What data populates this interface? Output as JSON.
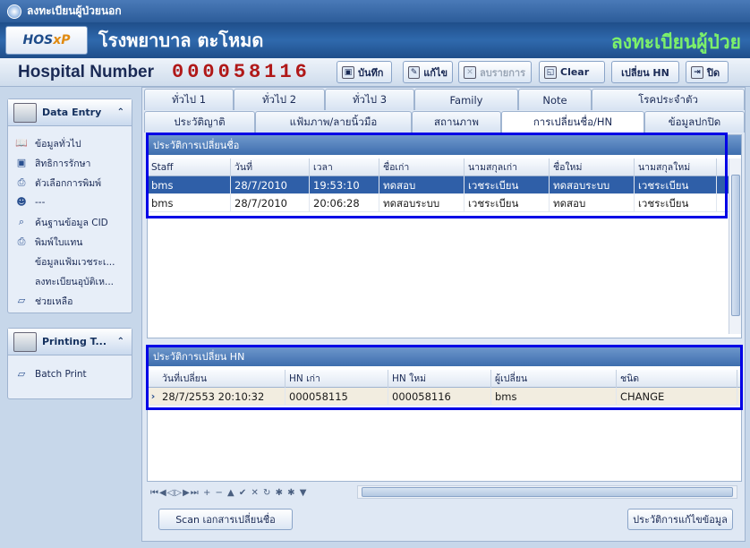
{
  "window": {
    "title": "ลงทะเบียนผู้ป่วยนอก"
  },
  "banner": {
    "logo_hos": "HOS",
    "logo_xp": "xP",
    "hospital": "โรงพยาบาล ตะโหมด",
    "register_title": "ลงทะเบียนผู้ป่วย"
  },
  "toolbar": {
    "hn_label": "Hospital Number",
    "hn_value": "000058116",
    "save_label": "บันทึก",
    "edit_label": "แก้ไข",
    "delete_label": "ลบรายการ",
    "clear_label": "Clear",
    "change_hn_label": "เปลี่ยน HN",
    "close_label": "ปิด"
  },
  "sidebar": {
    "data_entry_title": "Data Entry",
    "items": [
      {
        "label": "ข้อมูลทั่วไป",
        "icon": "book-icon"
      },
      {
        "label": "สิทธิการรักษา",
        "icon": "card-icon"
      },
      {
        "label": "ตัวเลือกการพิมพ์",
        "icon": "printer-icon"
      },
      {
        "label": "---",
        "icon": "users-icon"
      },
      {
        "label": "ค้นฐานข้อมูล CID",
        "icon": "search-db-icon"
      },
      {
        "label": "พิมพ์ใบแทน",
        "icon": "printer-icon"
      },
      {
        "label": "ข้อมูลแฟ้มเวชระเ...",
        "icon": ""
      },
      {
        "label": "ลงทะเบียนอุบัติเห...",
        "icon": ""
      },
      {
        "label": "ช่วยเหลือ",
        "icon": "help-icon"
      }
    ],
    "printing_title": "Printing T...",
    "printing_items": [
      {
        "label": "Batch Print",
        "icon": "batch-print-icon"
      }
    ]
  },
  "tabs_row1": [
    "ทั่วไป 1",
    "ทั่วไป 2",
    "ทั่วไป 3",
    "Family",
    "Note",
    "โรคประจำตัว"
  ],
  "tabs_row2": [
    "ประวัติญาติ",
    "แฟ้มภาพ/ลายนิ้วมือ",
    "สถานภาพ",
    "การเปลี่ยนชื่อ/HN",
    "ข้อมูลปกปิด"
  ],
  "name_history": {
    "title": "ประวัติการเปลี่ยนชื่อ",
    "columns": [
      "Staff",
      "วันที่",
      "เวลา",
      "ชื่อเก่า",
      "นามสกุลเก่า",
      "ชื่อใหม่",
      "นามสกุลใหม่"
    ],
    "rows": [
      [
        "bms",
        "28/7/2010",
        "19:53:10",
        "ทดสอบ",
        "เวชระเบียน",
        "ทดสอบระบบ",
        "เวชระเบียน"
      ],
      [
        "bms",
        "28/7/2010",
        "20:06:28",
        "ทดสอบระบบ",
        "เวชระเบียน",
        "ทดสอบ",
        "เวชระเบียน"
      ]
    ]
  },
  "hn_history": {
    "title": "ประวัติการเปลี่ยน HN",
    "columns": [
      "วันที่เปลี่ยน",
      "HN เก่า",
      "HN ใหม่",
      "ผู้เปลี่ยน",
      "ชนิด"
    ],
    "rows": [
      [
        "28/7/2553 20:10:32",
        "000058115",
        "000058116",
        "bms",
        "CHANGE"
      ]
    ]
  },
  "buttons": {
    "scan_label": "Scan เอกสารเปลี่ยนชื่อ",
    "edit_history_label": "ประวัติการแก้ไขข้อมูล"
  },
  "nav": "⏮◀◁▷▶⏭ + − ▲ ✔ ✕ ↻ ✱ ✱ ▼",
  "colors": {
    "highlight": "#0000e6",
    "selected_row": "#2f5fa8",
    "hn_value": "#b01818"
  }
}
